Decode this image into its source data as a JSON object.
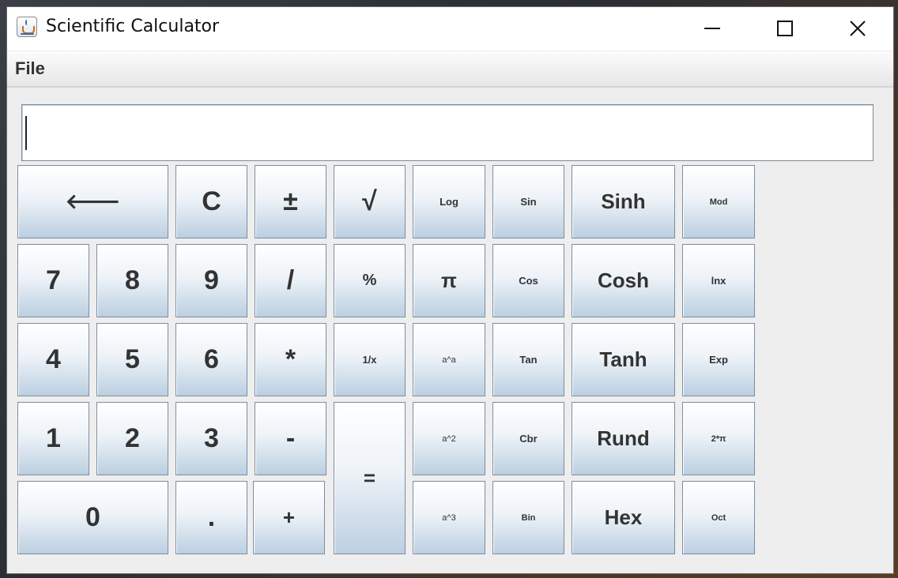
{
  "window": {
    "title": "Scientific Calculator",
    "icon": "java-cup-icon",
    "controls": [
      "minimize-icon",
      "maximize-icon",
      "close-icon"
    ]
  },
  "menu": {
    "file": "File"
  },
  "display": {
    "value": ""
  },
  "buttons": {
    "backspace": "🡐",
    "clear": "C",
    "plusminus": "±",
    "sqrt": "√",
    "log": "Log",
    "sin": "Sin",
    "sinh": "Sinh",
    "mod": "Mod",
    "seven": "7",
    "eight": "8",
    "nine": "9",
    "divide": "/",
    "percent": "%",
    "pi": "π",
    "cos": "Cos",
    "cosh": "Cosh",
    "lnx": "lnx",
    "four": "4",
    "five": "5",
    "six": "6",
    "multiply": "*",
    "reciprocal": "1/x",
    "a_pow_a": "a^a",
    "tan": "Tan",
    "tanh": "Tanh",
    "exp": "Exp",
    "one": "1",
    "two": "2",
    "three": "3",
    "minus": "-",
    "equals": "=",
    "a_pow_2": "a^2",
    "cbr": "Cbr",
    "rund": "Rund",
    "two_pi": "2*π",
    "zero": "0",
    "dot": ".",
    "plus": "+",
    "a_pow_3": "a^3",
    "bin": "Bin",
    "hex": "Hex",
    "oct": "Oct"
  }
}
